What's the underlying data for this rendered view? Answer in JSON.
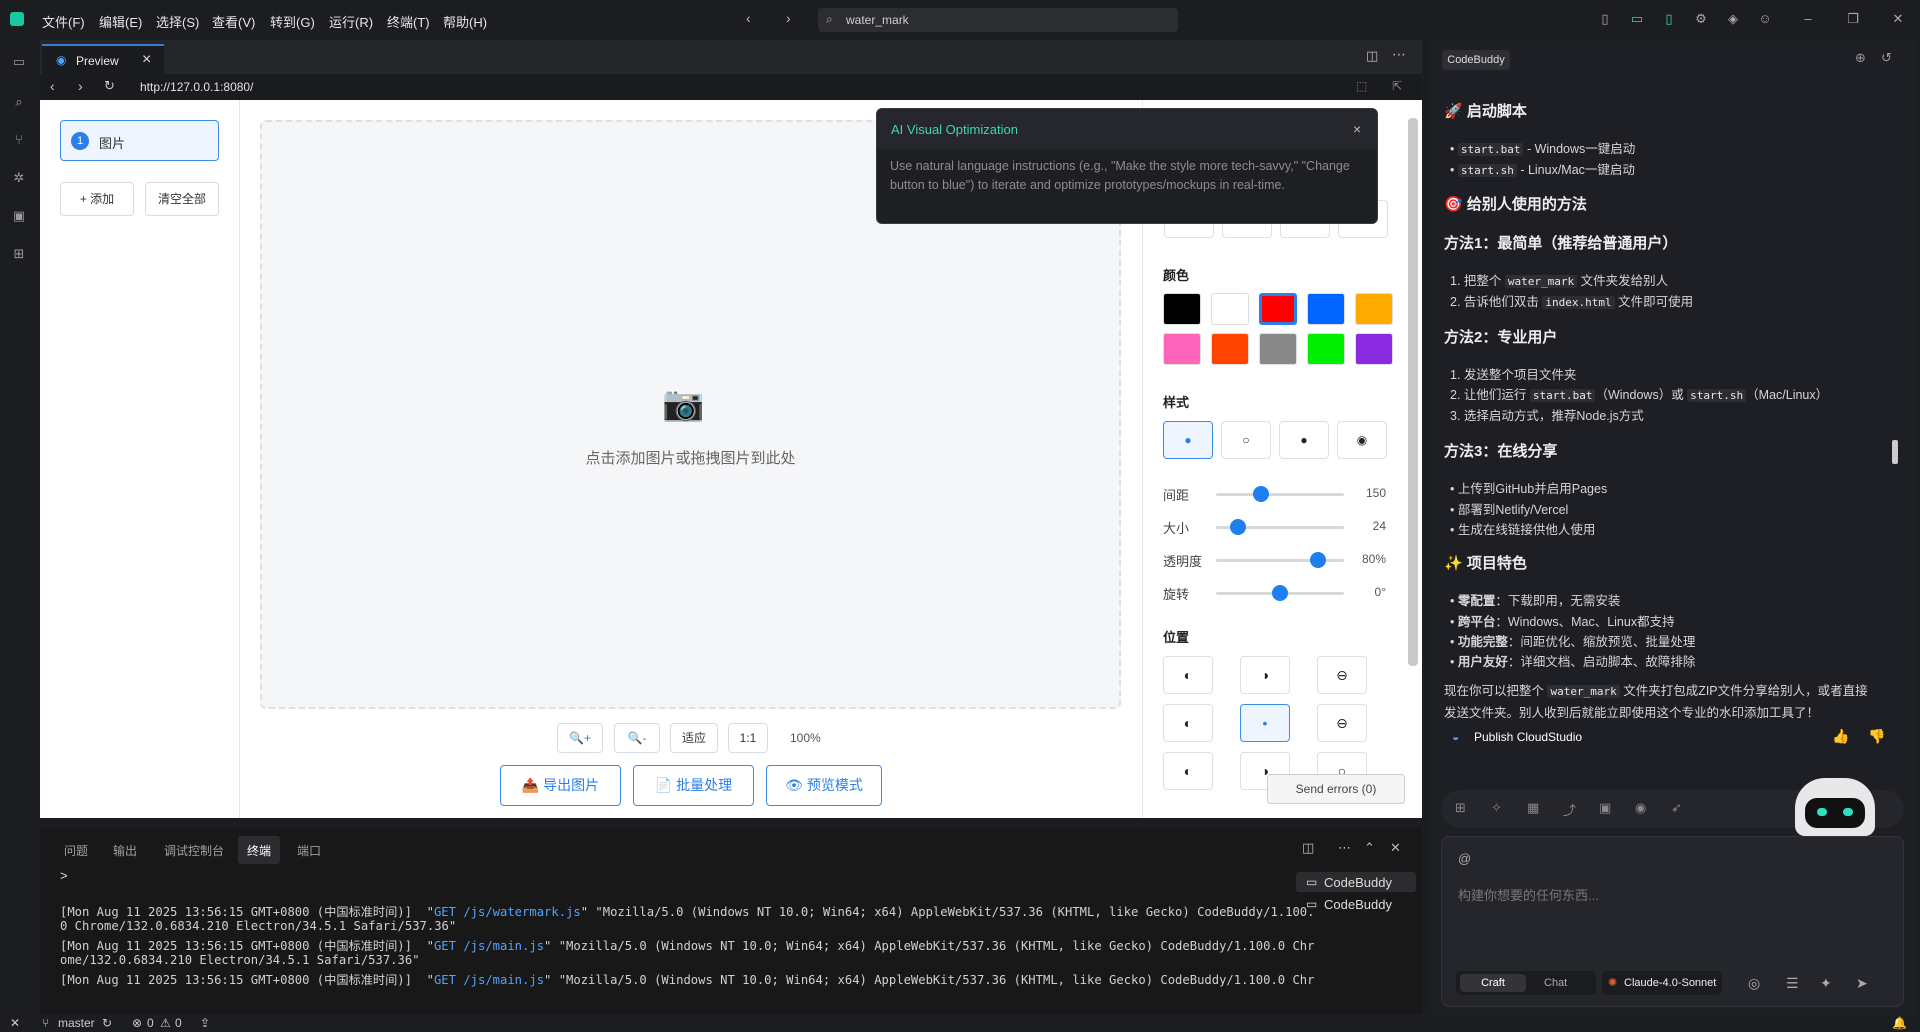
{
  "menu": [
    "文件(F)",
    "编辑(E)",
    "选择(S)",
    "查看(V)",
    "转到(G)",
    "运行(R)",
    "终端(T)",
    "帮助(H)"
  ],
  "search": {
    "value": "water_mark"
  },
  "tab": {
    "label": "Preview"
  },
  "url": "http://127.0.0.1:8080/",
  "sidebar": {
    "item_num": "1",
    "item_label": "图片",
    "add": "+ 添加",
    "clear": "清空全部"
  },
  "drop_tip": "点击添加图片或拖拽图片到此处",
  "zoom": {
    "zoom_in": "🔍+",
    "zoom_out": "🔍-",
    "fit": "适应",
    "one": "1:1",
    "pct": "100%"
  },
  "actions": {
    "export": "📤 导出图片",
    "batch": "📄 批量处理",
    "preview": "👁 预览模式"
  },
  "settings": {
    "color_title": "颜色",
    "colors": [
      "#000000",
      "#ffffff",
      "#ff0000",
      "#0066ff",
      "#ffaa00",
      "#ff66bb",
      "#ff4400",
      "#888888",
      "#00ee00",
      "#8a2be2"
    ],
    "style_title": "样式",
    "styles": [
      "●",
      "○",
      "●",
      "◉"
    ],
    "sliders": [
      {
        "label": "间距",
        "value": "150",
        "frac": 0.35
      },
      {
        "label": "大小",
        "value": "24",
        "frac": 0.17
      },
      {
        "label": "透明度",
        "value": "80%",
        "frac": 0.8
      },
      {
        "label": "旋转",
        "value": "0°",
        "frac": 0.5
      }
    ],
    "pos_title": "位置",
    "positions": [
      "◐",
      "◑",
      "⊖",
      "◐",
      "•",
      "⊖",
      "◐",
      "◑",
      "○"
    ]
  },
  "popup": {
    "title": "AI Visual Optimization",
    "close": "×",
    "desc": "Use natural language instructions (e.g., \"Make the style more tech-savvy,\" \"Change button to blue\") to iterate and optimize prototypes/mockups in real-time."
  },
  "send_errors": "Send errors (0)",
  "panel": {
    "tabs": [
      "问题",
      "输出",
      "调试控制台",
      "终端",
      "端口"
    ],
    "prompt": ">",
    "terminals": [
      "CodeBuddy",
      "CodeBuddy"
    ],
    "log": [
      [
        "[Mon Aug 11 2025 13:56:15 GMT+0800 (中国标准时间)]  \"",
        "GET /js/watermark.js",
        "\" \"Mozilla/5.0 (Windows NT 10.0; Win64; x64) AppleWebKit/537.36 (KHTML, like Gecko) CodeBuddy/1.100."
      ],
      [
        "0 Chrome/132.0.6834.210 Electron/34.5.1 Safari/537.36\"",
        "",
        ""
      ],
      [
        "[Mon Aug 11 2025 13:56:15 GMT+0800 (中国标准时间)]  \"",
        "GET /js/main.js",
        "\" \"Mozilla/5.0 (Windows NT 10.0; Win64; x64) AppleWebKit/537.36 (KHTML, like Gecko) CodeBuddy/1.100.0 Chr"
      ],
      [
        "ome/132.0.6834.210 Electron/34.5.1 Safari/537.36\"",
        "",
        ""
      ],
      [
        "[Mon Aug 11 2025 13:56:15 GMT+0800 (中国标准时间)]  \"",
        "GET /js/main.js",
        "\" \"Mozilla/5.0 (Windows NT 10.0; Win64; x64) AppleWebKit/537.36 (KHTML, like Gecko) CodeBuddy/1.100.0 Chr"
      ]
    ]
  },
  "chat": {
    "tab": "CodeBuddy",
    "h_start": "🚀 启动脚本",
    "start_items": [
      [
        "start.bat",
        " - Windows一键启动"
      ],
      [
        "start.sh",
        " - Linux/Mac一键启动"
      ]
    ],
    "h_share": "🎯 给别人使用的方法",
    "m1": "方法1：最简单（推荐给普通用户）",
    "m1_items": [
      [
        "1. 把整个 ",
        "water_mark",
        " 文件夹发给别人"
      ],
      [
        "2. 告诉他们双击 ",
        "index.html",
        " 文件即可使用"
      ]
    ],
    "m2": "方法2：专业用户",
    "m2_a": "1. 发送整个项目文件夹",
    "m2_b": [
      "2. 让他们运行 ",
      "start.bat",
      "（Windows）或 ",
      "start.sh",
      "（Mac/Linux）"
    ],
    "m2_c": "3. 选择启动方式，推荐Node.js方式",
    "m3": "方法3：在线分享",
    "m3_items": [
      "上传到GitHub并启用Pages",
      "部署到Netlify/Vercel",
      "生成在线链接供他人使用"
    ],
    "h_feat": "✨ 项目特色",
    "feat": [
      [
        "零配置",
        "：下载即用，无需安装"
      ],
      [
        "跨平台",
        "：Windows、Mac、Linux都支持"
      ],
      [
        "功能完整",
        "：间距优化、缩放预览、批量处理"
      ],
      [
        "用户友好",
        "：详细文档、启动脚本、故障排除"
      ]
    ],
    "final_a": "现在你可以把整个 ",
    "final_code": "water_mark",
    "final_b": " 文件夹打包成ZIP文件分享给别人，或者直接",
    "final_c": "发送文件夹。别人收到后就能立即使用这个专业的水印添加工具了！",
    "publish": "Publish CloudStudio",
    "at": "@",
    "placeholder": "构建你想要的任何东西...",
    "craft": "Craft",
    "chatmode": "Chat",
    "model": "Claude-4.0-Sonnet"
  },
  "status": {
    "branch": "master",
    "errors": "0",
    "warnings": "0"
  }
}
